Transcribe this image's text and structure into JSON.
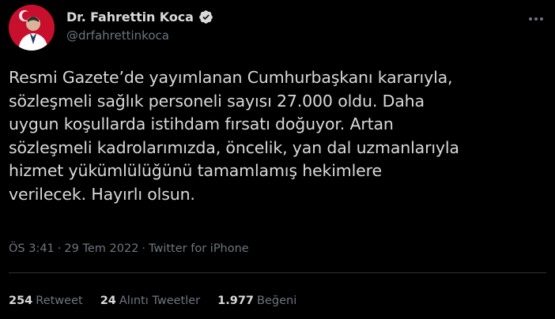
{
  "author": {
    "display_name": "Dr. Fahrettin Koca",
    "handle": "@drfahrettinkoca",
    "verified": true,
    "avatar": "profile-photo"
  },
  "tweet": {
    "text": "Resmi Gazete’de yayımlanan Cumhurbaşkanı kararıyla,\nsözleşmeli sağlık personeli sayısı 27.000 oldu. Daha\nuygun koşullarda istihdam fırsatı doğuyor. Artan\nsözleşmeli kadrolarımızda, öncelik, yan dal uzmanlarıyla\nhizmet yükümlülüğünü tamamlamış hekimlere\nverilecek. Hayırlı olsun.",
    "time": "ÖS 3:41",
    "separator": "·",
    "date": "29 Tem 2022",
    "source": "Twitter for iPhone"
  },
  "stats": {
    "retweets_count": "254",
    "retweets_label": "Retweet",
    "quotes_count": "24",
    "quotes_label": "Alıntı Tweetler",
    "likes_count": "1.977",
    "likes_label": "Beğeni"
  },
  "colors": {
    "background": "#000000",
    "text": "#d9d9d9",
    "secondary": "#6e767d",
    "verified_badge": "#d9d9d9",
    "avatar_bg": "#c8102e"
  }
}
